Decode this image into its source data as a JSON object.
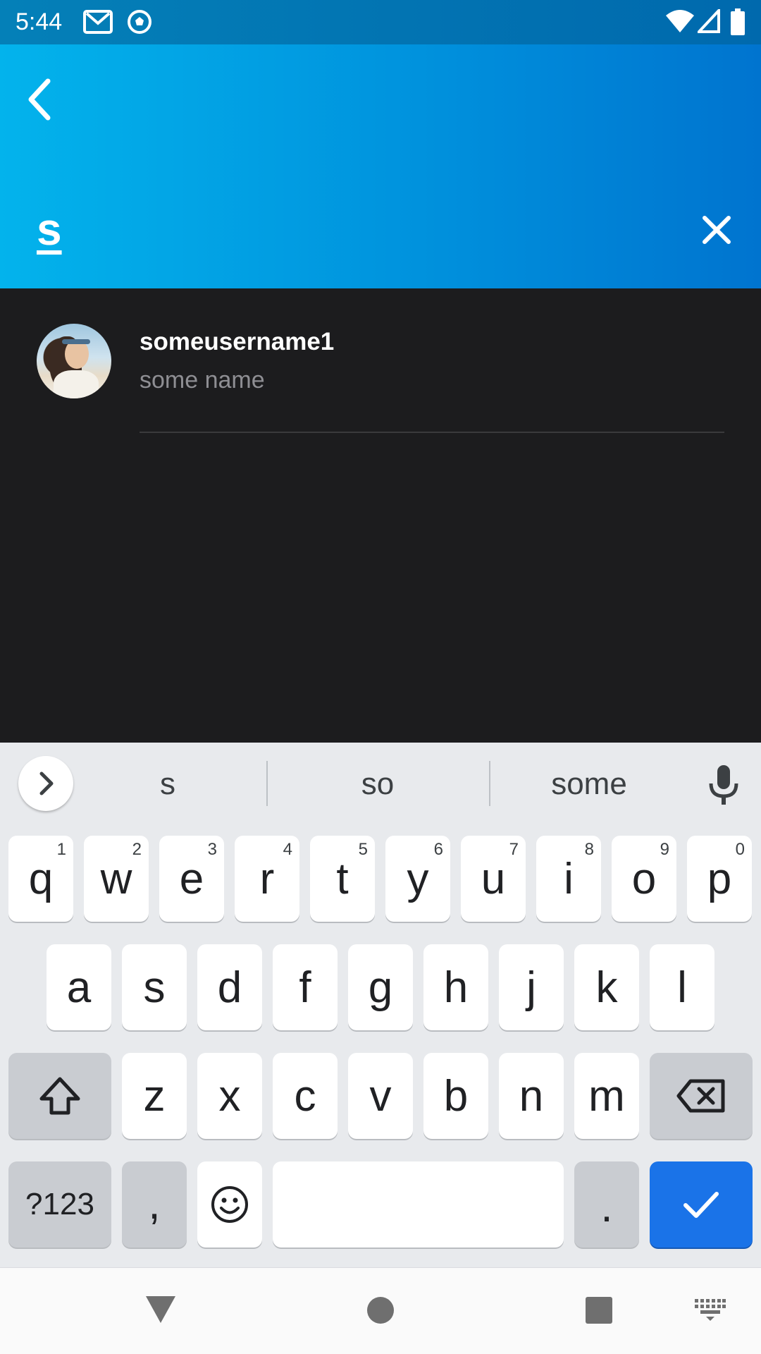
{
  "status_bar": {
    "time": "5:44",
    "icons": [
      "gmail-icon",
      "soccer-ball-icon",
      "wifi-icon",
      "signal-icon",
      "battery-icon"
    ]
  },
  "header": {
    "back_icon": "chevron-left-icon",
    "search_query": "s",
    "clear_icon": "close-icon",
    "gradient_colors": [
      "#03b3ec",
      "#0074cf"
    ]
  },
  "results": [
    {
      "username": "someusername1",
      "name": "some name",
      "avatar": "profile-photo"
    }
  ],
  "keyboard": {
    "suggestions": [
      "s",
      "so",
      "some"
    ],
    "rows": [
      [
        {
          "label": "q",
          "hint": "1"
        },
        {
          "label": "w",
          "hint": "2"
        },
        {
          "label": "e",
          "hint": "3"
        },
        {
          "label": "r",
          "hint": "4"
        },
        {
          "label": "t",
          "hint": "5"
        },
        {
          "label": "y",
          "hint": "6"
        },
        {
          "label": "u",
          "hint": "7"
        },
        {
          "label": "i",
          "hint": "8"
        },
        {
          "label": "o",
          "hint": "9"
        },
        {
          "label": "p",
          "hint": "0"
        }
      ],
      [
        {
          "label": "a"
        },
        {
          "label": "s"
        },
        {
          "label": "d"
        },
        {
          "label": "f"
        },
        {
          "label": "g"
        },
        {
          "label": "h"
        },
        {
          "label": "j"
        },
        {
          "label": "k"
        },
        {
          "label": "l"
        }
      ],
      [
        {
          "label": "z"
        },
        {
          "label": "x"
        },
        {
          "label": "c"
        },
        {
          "label": "v"
        },
        {
          "label": "b"
        },
        {
          "label": "n"
        },
        {
          "label": "m"
        }
      ]
    ],
    "symbols_label": "?123",
    "comma_label": ",",
    "period_label": ".",
    "action_color": "#1a73e8"
  },
  "nav_bar": {
    "icons": [
      "back-triangle-icon",
      "home-circle-icon",
      "recents-square-icon",
      "keyboard-switch-icon"
    ]
  }
}
